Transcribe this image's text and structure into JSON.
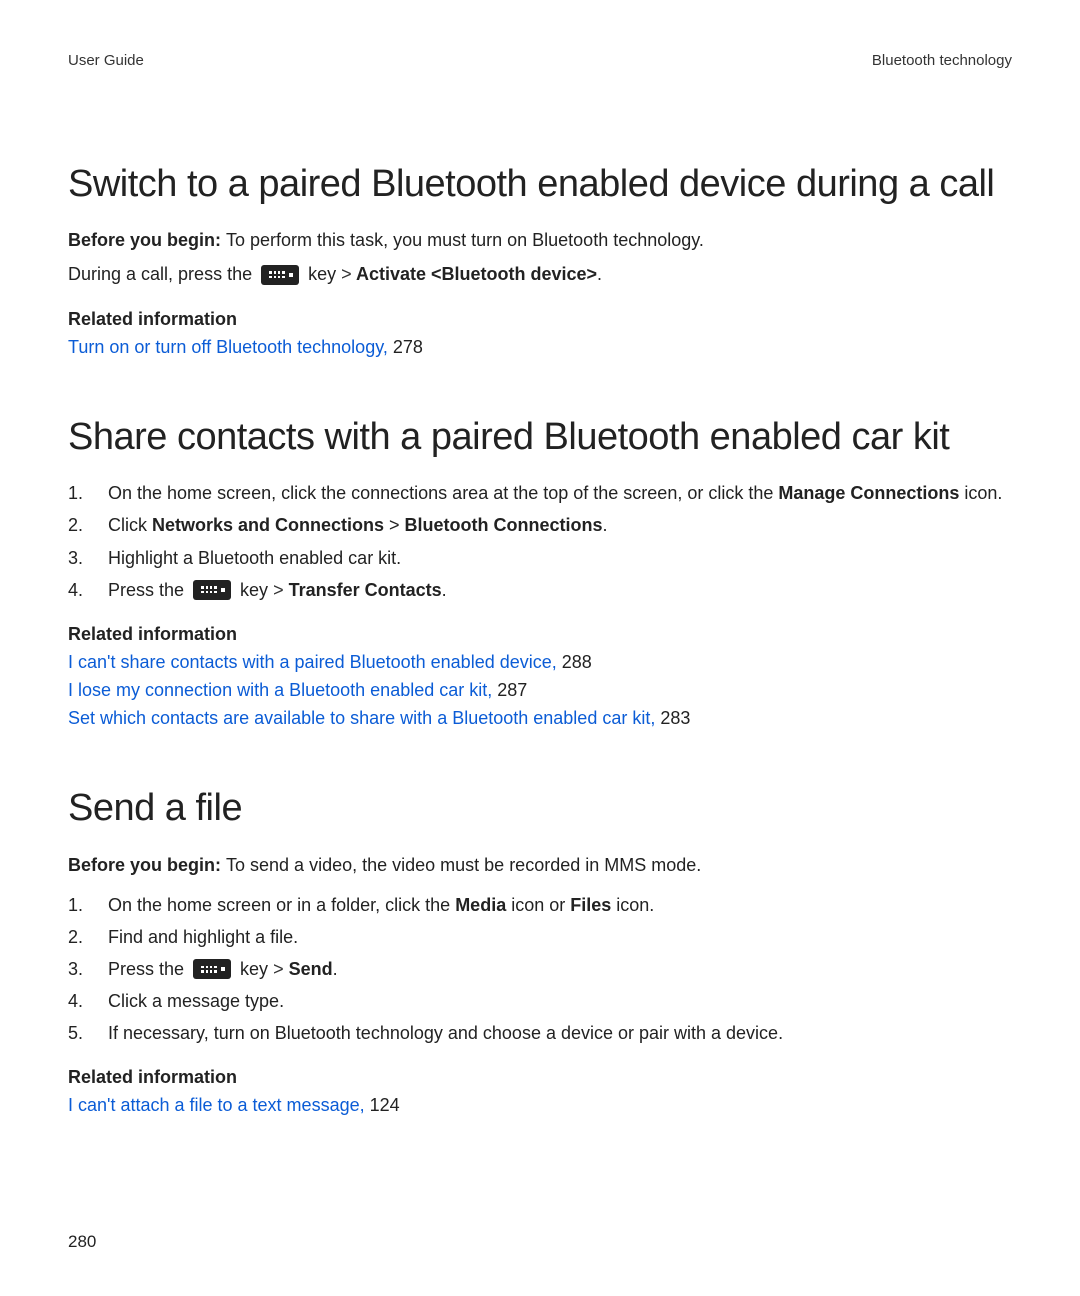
{
  "header": {
    "left": "User Guide",
    "right": "Bluetooth technology"
  },
  "page_number": "280",
  "s1": {
    "title": "Switch to a paired Bluetooth enabled device during a call",
    "before_label": "Before you begin: ",
    "before_text": "To perform this task, you must turn on Bluetooth technology.",
    "line_a": "During a call, press the ",
    "line_b": " key ",
    "line_gt": ">",
    "line_c": " Activate ",
    "line_d": "<Bluetooth device>",
    "line_e": ".",
    "related_label": "Related information",
    "link1": "Turn on or turn off Bluetooth technology, ",
    "link1_page": "278"
  },
  "s2": {
    "title": "Share contacts with a paired Bluetooth enabled car kit",
    "li1a": "On the home screen, click the connections area at the top of the screen, or click the ",
    "li1b": "Manage Connections",
    "li1c": " icon.",
    "li2a": "Click ",
    "li2b": "Networks and Connections",
    "li2gt": " > ",
    "li2c": "Bluetooth Connections",
    "li2d": ".",
    "li3": "Highlight a Bluetooth enabled car kit.",
    "li4a": "Press the ",
    "li4b": " key ",
    "li4gt": ">",
    "li4c": " Transfer Contacts",
    "li4d": ".",
    "related_label": "Related information",
    "link1": "I can't share contacts with a paired Bluetooth enabled device, ",
    "link1_page": "288",
    "link2": "I lose my connection with a Bluetooth enabled car kit, ",
    "link2_page": "287",
    "link3": "Set which contacts are available to share with a Bluetooth enabled car kit, ",
    "link3_page": "283"
  },
  "s3": {
    "title": "Send a file",
    "before_label": "Before you begin: ",
    "before_text": "To send a video, the video must be recorded in MMS mode.",
    "li1a": "On the home screen or in a folder, click the ",
    "li1b": "Media",
    "li1c": " icon or ",
    "li1d": "Files",
    "li1e": " icon.",
    "li2": "Find and highlight a file.",
    "li3a": "Press the ",
    "li3b": " key ",
    "li3gt": ">",
    "li3c": " Send",
    "li3d": ".",
    "li4": "Click a message type.",
    "li5": "If necessary, turn on Bluetooth technology and choose a device or pair with a device.",
    "related_label": "Related information",
    "link1": "I can't attach a file to a text message, ",
    "link1_page": "124"
  },
  "nums": {
    "n1": "1.",
    "n2": "2.",
    "n3": "3.",
    "n4": "4.",
    "n5": "5."
  }
}
